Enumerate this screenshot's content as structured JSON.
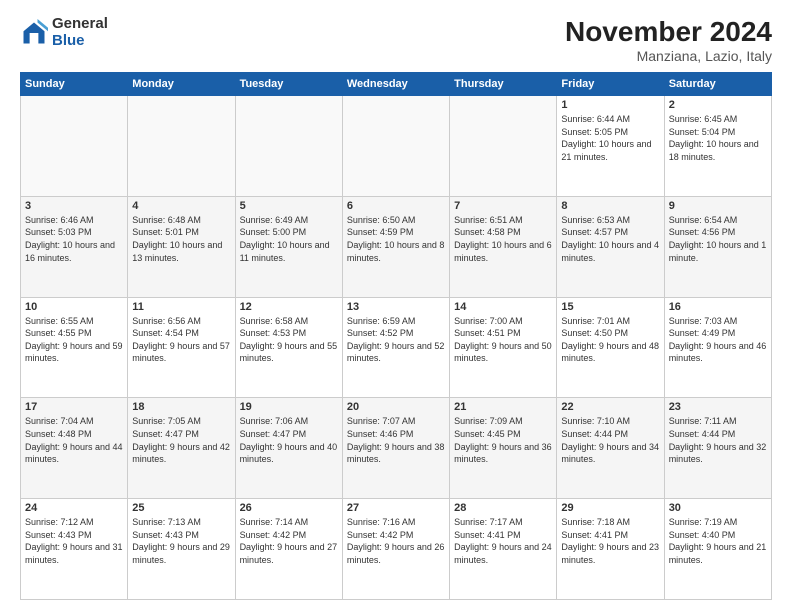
{
  "logo": {
    "general": "General",
    "blue": "Blue"
  },
  "title": "November 2024",
  "location": "Manziana, Lazio, Italy",
  "days_header": [
    "Sunday",
    "Monday",
    "Tuesday",
    "Wednesday",
    "Thursday",
    "Friday",
    "Saturday"
  ],
  "weeks": [
    [
      {
        "day": "",
        "info": ""
      },
      {
        "day": "",
        "info": ""
      },
      {
        "day": "",
        "info": ""
      },
      {
        "day": "",
        "info": ""
      },
      {
        "day": "",
        "info": ""
      },
      {
        "day": "1",
        "info": "Sunrise: 6:44 AM\nSunset: 5:05 PM\nDaylight: 10 hours and 21 minutes."
      },
      {
        "day": "2",
        "info": "Sunrise: 6:45 AM\nSunset: 5:04 PM\nDaylight: 10 hours and 18 minutes."
      }
    ],
    [
      {
        "day": "3",
        "info": "Sunrise: 6:46 AM\nSunset: 5:03 PM\nDaylight: 10 hours and 16 minutes."
      },
      {
        "day": "4",
        "info": "Sunrise: 6:48 AM\nSunset: 5:01 PM\nDaylight: 10 hours and 13 minutes."
      },
      {
        "day": "5",
        "info": "Sunrise: 6:49 AM\nSunset: 5:00 PM\nDaylight: 10 hours and 11 minutes."
      },
      {
        "day": "6",
        "info": "Sunrise: 6:50 AM\nSunset: 4:59 PM\nDaylight: 10 hours and 8 minutes."
      },
      {
        "day": "7",
        "info": "Sunrise: 6:51 AM\nSunset: 4:58 PM\nDaylight: 10 hours and 6 minutes."
      },
      {
        "day": "8",
        "info": "Sunrise: 6:53 AM\nSunset: 4:57 PM\nDaylight: 10 hours and 4 minutes."
      },
      {
        "day": "9",
        "info": "Sunrise: 6:54 AM\nSunset: 4:56 PM\nDaylight: 10 hours and 1 minute."
      }
    ],
    [
      {
        "day": "10",
        "info": "Sunrise: 6:55 AM\nSunset: 4:55 PM\nDaylight: 9 hours and 59 minutes."
      },
      {
        "day": "11",
        "info": "Sunrise: 6:56 AM\nSunset: 4:54 PM\nDaylight: 9 hours and 57 minutes."
      },
      {
        "day": "12",
        "info": "Sunrise: 6:58 AM\nSunset: 4:53 PM\nDaylight: 9 hours and 55 minutes."
      },
      {
        "day": "13",
        "info": "Sunrise: 6:59 AM\nSunset: 4:52 PM\nDaylight: 9 hours and 52 minutes."
      },
      {
        "day": "14",
        "info": "Sunrise: 7:00 AM\nSunset: 4:51 PM\nDaylight: 9 hours and 50 minutes."
      },
      {
        "day": "15",
        "info": "Sunrise: 7:01 AM\nSunset: 4:50 PM\nDaylight: 9 hours and 48 minutes."
      },
      {
        "day": "16",
        "info": "Sunrise: 7:03 AM\nSunset: 4:49 PM\nDaylight: 9 hours and 46 minutes."
      }
    ],
    [
      {
        "day": "17",
        "info": "Sunrise: 7:04 AM\nSunset: 4:48 PM\nDaylight: 9 hours and 44 minutes."
      },
      {
        "day": "18",
        "info": "Sunrise: 7:05 AM\nSunset: 4:47 PM\nDaylight: 9 hours and 42 minutes."
      },
      {
        "day": "19",
        "info": "Sunrise: 7:06 AM\nSunset: 4:47 PM\nDaylight: 9 hours and 40 minutes."
      },
      {
        "day": "20",
        "info": "Sunrise: 7:07 AM\nSunset: 4:46 PM\nDaylight: 9 hours and 38 minutes."
      },
      {
        "day": "21",
        "info": "Sunrise: 7:09 AM\nSunset: 4:45 PM\nDaylight: 9 hours and 36 minutes."
      },
      {
        "day": "22",
        "info": "Sunrise: 7:10 AM\nSunset: 4:44 PM\nDaylight: 9 hours and 34 minutes."
      },
      {
        "day": "23",
        "info": "Sunrise: 7:11 AM\nSunset: 4:44 PM\nDaylight: 9 hours and 32 minutes."
      }
    ],
    [
      {
        "day": "24",
        "info": "Sunrise: 7:12 AM\nSunset: 4:43 PM\nDaylight: 9 hours and 31 minutes."
      },
      {
        "day": "25",
        "info": "Sunrise: 7:13 AM\nSunset: 4:43 PM\nDaylight: 9 hours and 29 minutes."
      },
      {
        "day": "26",
        "info": "Sunrise: 7:14 AM\nSunset: 4:42 PM\nDaylight: 9 hours and 27 minutes."
      },
      {
        "day": "27",
        "info": "Sunrise: 7:16 AM\nSunset: 4:42 PM\nDaylight: 9 hours and 26 minutes."
      },
      {
        "day": "28",
        "info": "Sunrise: 7:17 AM\nSunset: 4:41 PM\nDaylight: 9 hours and 24 minutes."
      },
      {
        "day": "29",
        "info": "Sunrise: 7:18 AM\nSunset: 4:41 PM\nDaylight: 9 hours and 23 minutes."
      },
      {
        "day": "30",
        "info": "Sunrise: 7:19 AM\nSunset: 4:40 PM\nDaylight: 9 hours and 21 minutes."
      }
    ]
  ]
}
